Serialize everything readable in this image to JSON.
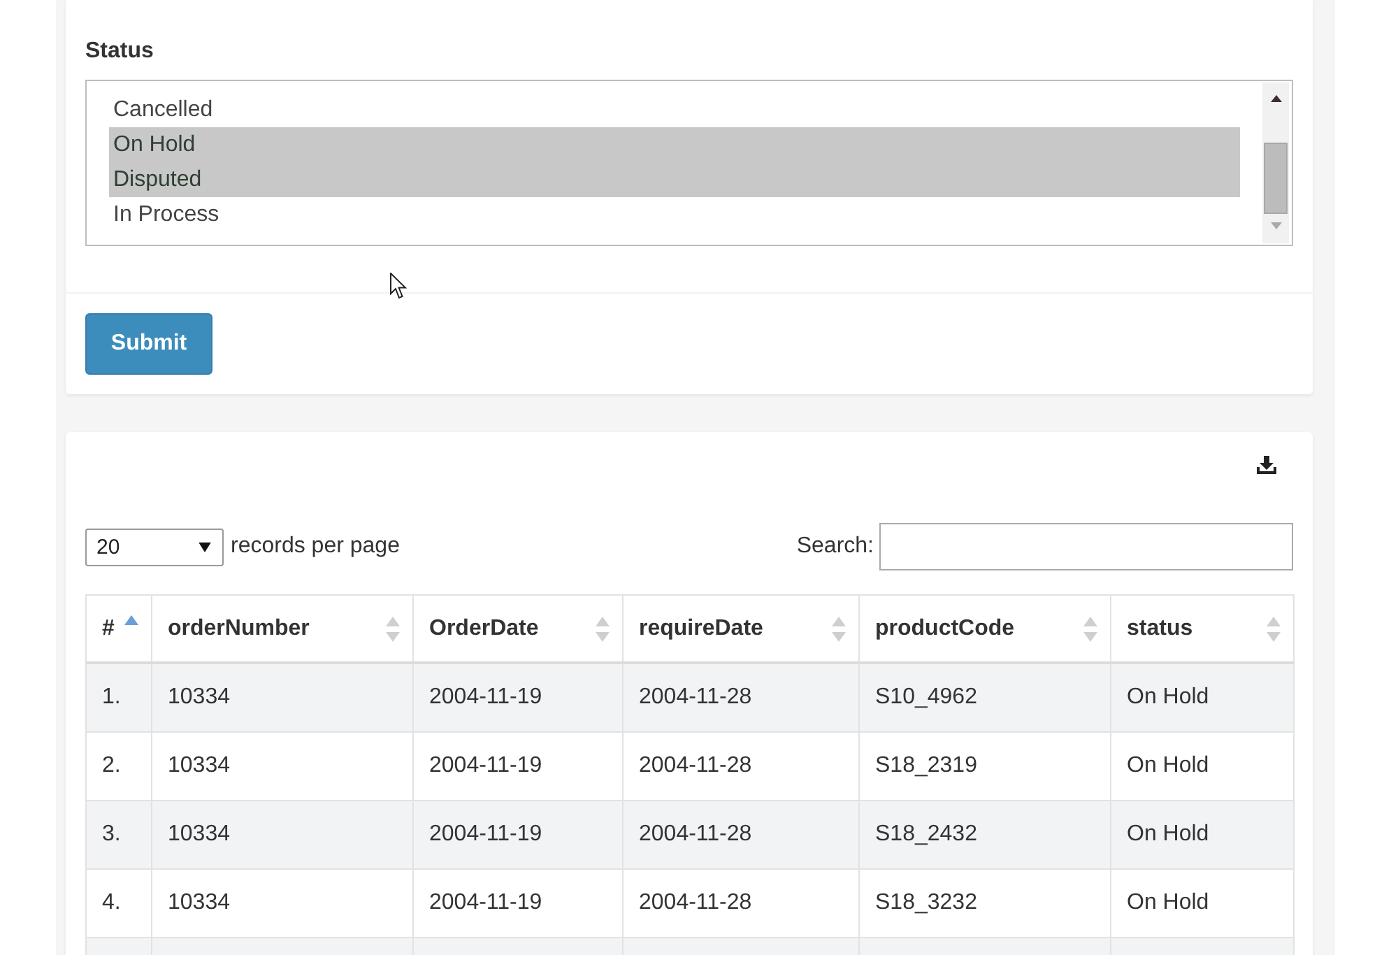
{
  "status_field": {
    "label": "Status",
    "options": [
      {
        "label": "Cancelled",
        "selected": false
      },
      {
        "label": "On Hold",
        "selected": true
      },
      {
        "label": "Disputed",
        "selected": true
      },
      {
        "label": "In Process",
        "selected": false
      }
    ]
  },
  "submit_button": {
    "label": "Submit"
  },
  "records_card": {
    "page_size": {
      "value": "20",
      "suffix": "records per page"
    },
    "search": {
      "label": "Search:"
    },
    "columns": [
      {
        "label": "#",
        "sorted": true
      },
      {
        "label": "orderNumber",
        "sorted": false
      },
      {
        "label": "OrderDate",
        "sorted": false
      },
      {
        "label": "requireDate",
        "sorted": false
      },
      {
        "label": "productCode",
        "sorted": false
      },
      {
        "label": "status",
        "sorted": false
      }
    ],
    "rows": [
      [
        "1.",
        "10334",
        "2004-11-19",
        "2004-11-28",
        "S10_4962",
        "On Hold"
      ],
      [
        "2.",
        "10334",
        "2004-11-19",
        "2004-11-28",
        "S18_2319",
        "On Hold"
      ],
      [
        "3.",
        "10334",
        "2004-11-19",
        "2004-11-28",
        "S18_2432",
        "On Hold"
      ],
      [
        "4.",
        "10334",
        "2004-11-19",
        "2004-11-28",
        "S18_3232",
        "On Hold"
      ]
    ]
  }
}
